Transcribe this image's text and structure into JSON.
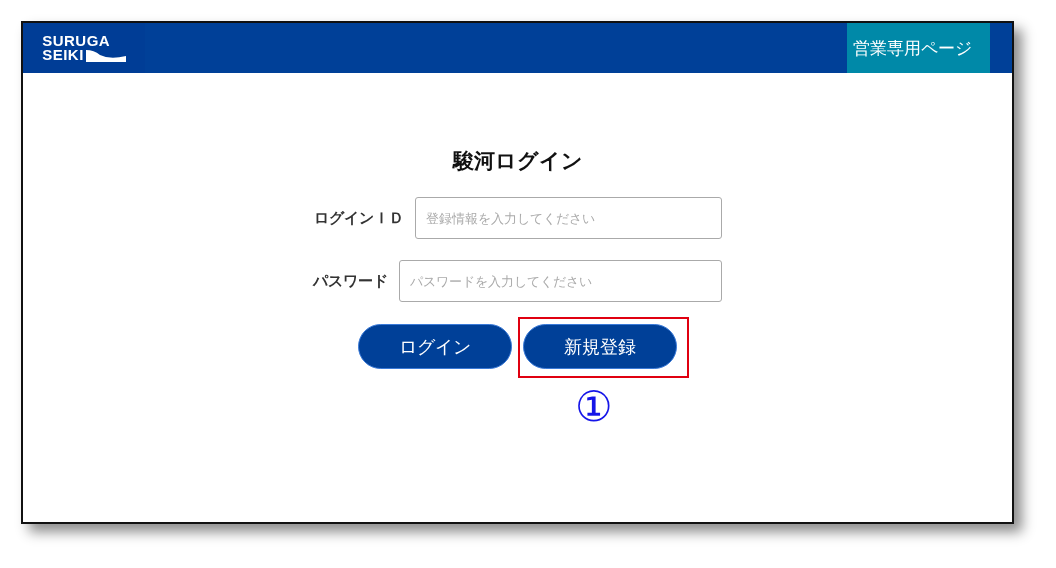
{
  "header": {
    "logo": [
      "SURUGA",
      "SEIKI"
    ],
    "link": "営業専用ページ"
  },
  "title": "駿河ログイン",
  "fields": [
    {
      "label": "ログインＩＤ",
      "placeholder": "登録情報を入力してください"
    },
    {
      "label": "パスワード",
      "placeholder": "パスワードを入力してください"
    }
  ],
  "buttons": [
    {
      "label": "ログイン",
      "highlighted": false
    },
    {
      "label": "新規登録",
      "highlighted": true,
      "callout": "①"
    }
  ]
}
